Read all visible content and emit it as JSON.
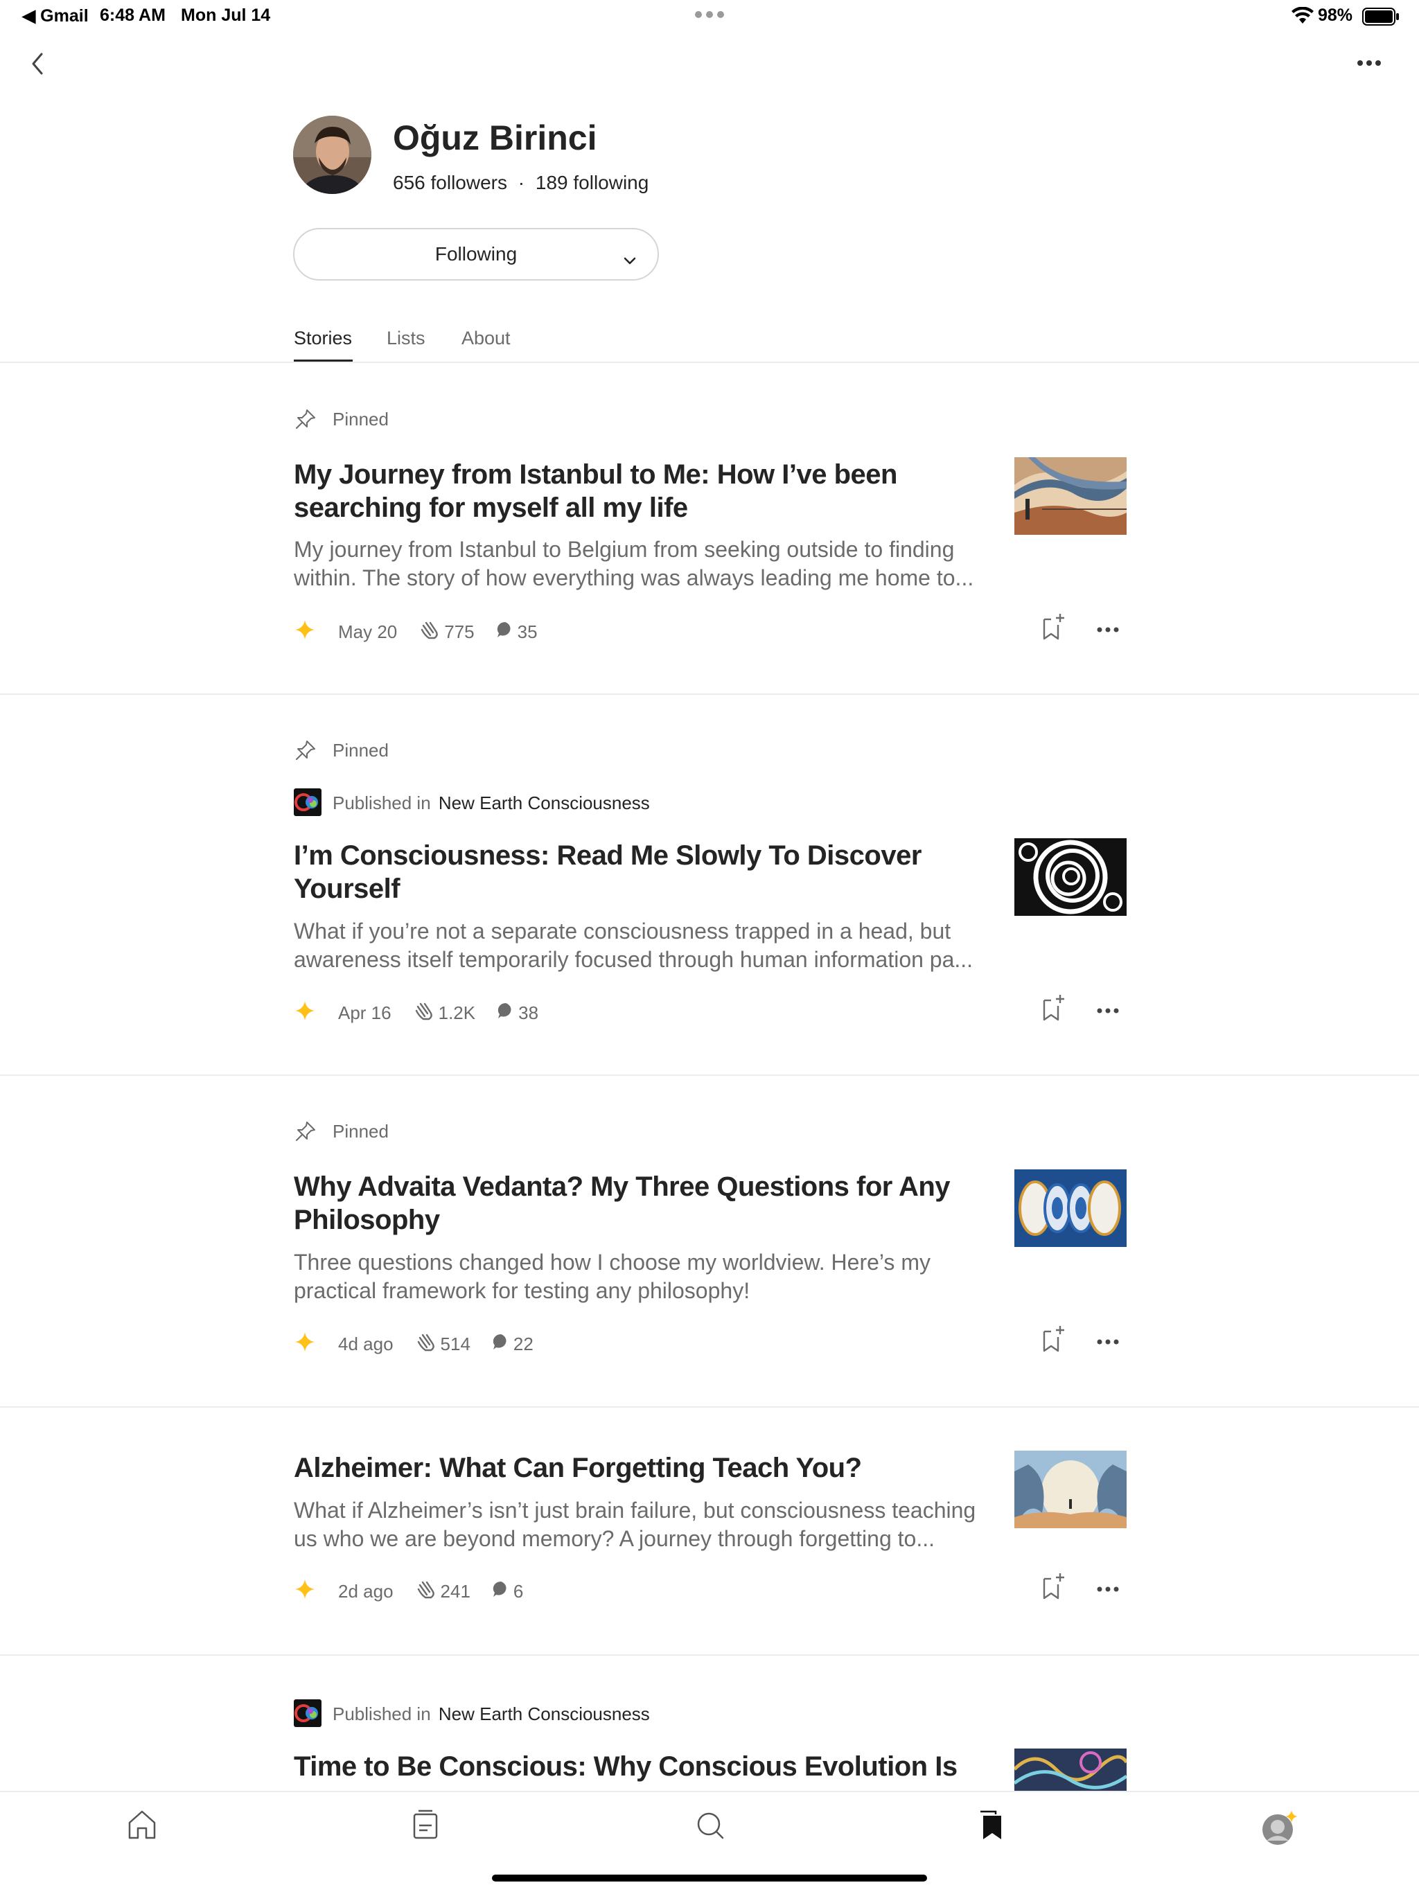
{
  "status_bar": {
    "back_app": "◀ Gmail",
    "time": "6:48 AM",
    "date": "Mon Jul 14",
    "battery": "98%"
  },
  "profile": {
    "name": "Oğuz Birinci",
    "followers": "656 followers",
    "separator": "·",
    "following_count": "189 following",
    "follow_button": "Following"
  },
  "tabs": [
    "Stories",
    "Lists",
    "About"
  ],
  "stories": [
    {
      "pinned": "Pinned",
      "title_lines": [
        "My Journey from Istanbul to Me: How I’ve been",
        "searching for myself all my life"
      ],
      "subtitle_lines": [
        "My journey from Istanbul to Belgium from seeking outside to finding",
        "within. The story of how everything was always leading me home to..."
      ],
      "date": "May 20",
      "claps": "775",
      "comments": "35"
    },
    {
      "pinned": "Pinned",
      "published_prefix": "Published in",
      "publication": "New Earth Consciousness",
      "title_lines": [
        "I’m Consciousness: Read Me Slowly To Discover",
        "Yourself"
      ],
      "subtitle_lines": [
        "What if you’re not a separate consciousness trapped in a head, but",
        "awareness itself temporarily focused through human information pa..."
      ],
      "date": "Apr 16",
      "claps": "1.2K",
      "comments": "38"
    },
    {
      "pinned": "Pinned",
      "title_lines": [
        "Why Advaita Vedanta? My Three Questions for Any",
        "Philosophy"
      ],
      "subtitle_lines": [
        "Three questions changed how I choose my worldview. Here’s my",
        "practical framework for testing any philosophy!"
      ],
      "date": "4d ago",
      "claps": "514",
      "comments": "22"
    },
    {
      "title_lines": [
        "Alzheimer: What Can Forgetting Teach You?"
      ],
      "subtitle_lines": [
        "What if Alzheimer’s isn’t just brain failure, but consciousness teaching",
        "us who we are beyond memory? A journey through forgetting to..."
      ],
      "date": "2d ago",
      "claps": "241",
      "comments": "6"
    },
    {
      "published_prefix": "Published in",
      "publication": "New Earth Consciousness",
      "title_lines": [
        "Time to Be Conscious: Why Conscious Evolution Is"
      ]
    }
  ],
  "bottom_nav": [
    "home-icon",
    "feed-icon",
    "search-icon",
    "bookmarks-icon",
    "profile-avatar"
  ],
  "colors": {
    "accent_star": "#FFC017",
    "text": "#242424",
    "muted": "#6B6B6B"
  }
}
